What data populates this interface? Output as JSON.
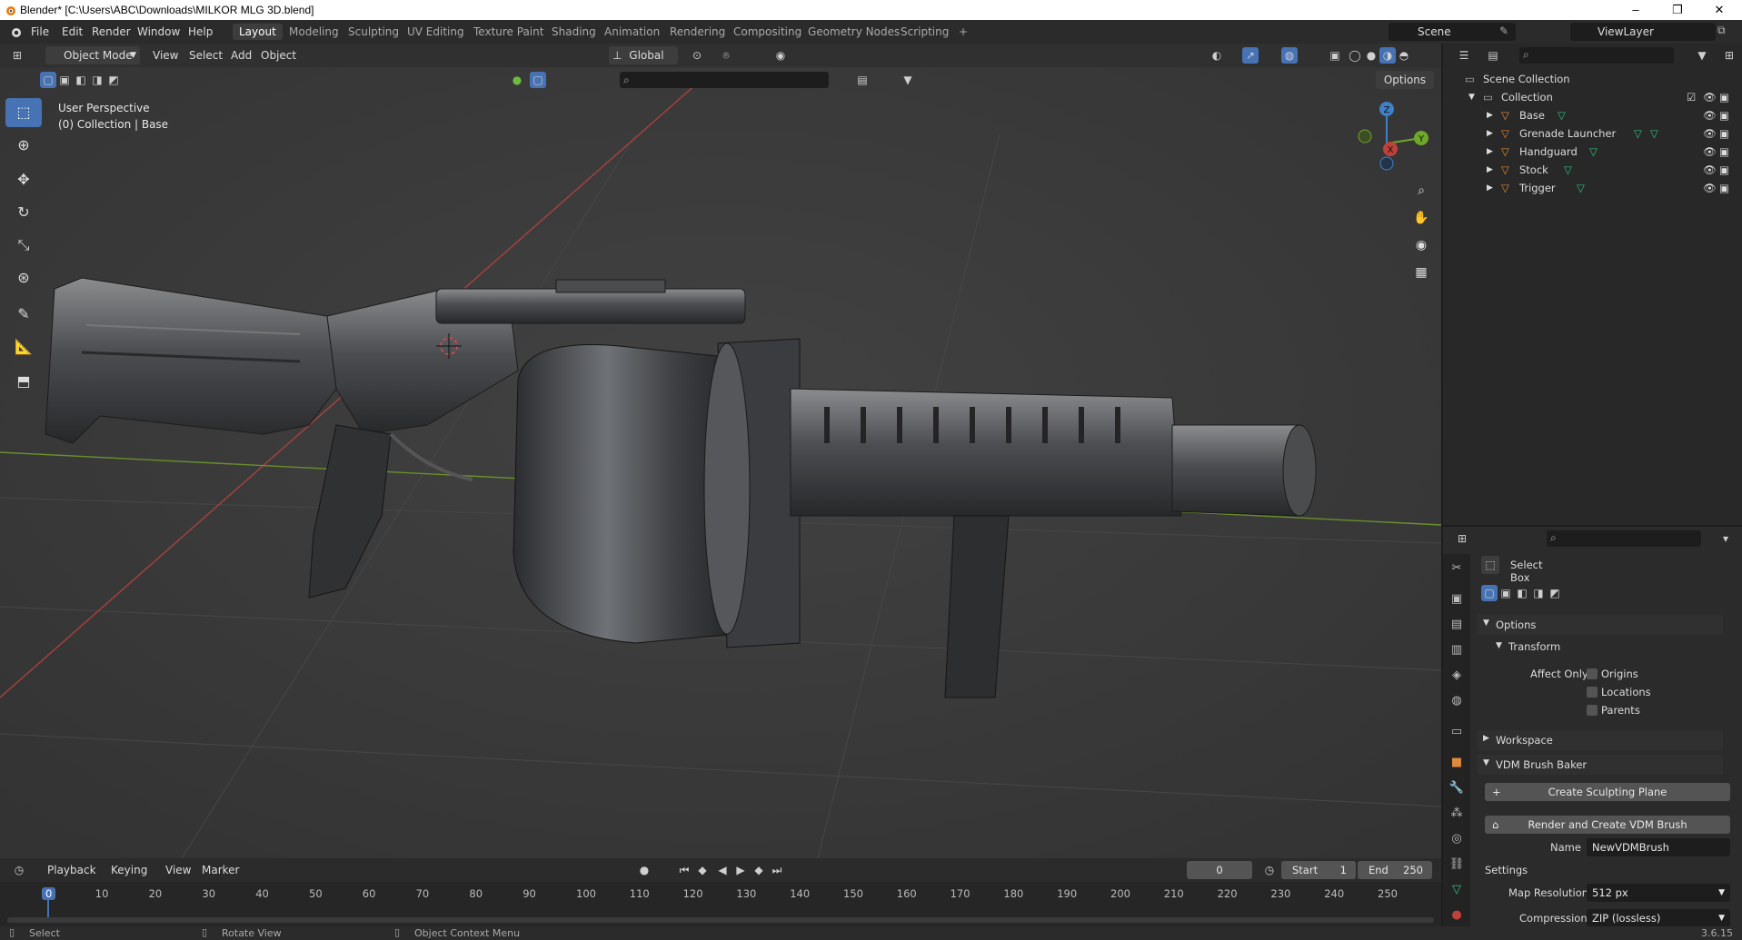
{
  "window": {
    "title": "Blender* [C:\\Users\\ABC\\Downloads\\MILKOR MLG 3D.blend]",
    "controls": [
      "–",
      "❐",
      "✕"
    ]
  },
  "menus": [
    "File",
    "Edit",
    "Render",
    "Window",
    "Help"
  ],
  "workspaces": [
    "Layout",
    "Modeling",
    "Sculpting",
    "UV Editing",
    "Texture Paint",
    "Shading",
    "Animation",
    "Rendering",
    "Compositing",
    "Geometry Nodes",
    "Scripting"
  ],
  "workspace_add": "+",
  "scene": {
    "label": "Scene",
    "view_layer": "ViewLayer"
  },
  "viewport": {
    "mode": "Object Mode",
    "menus": [
      "View",
      "Select",
      "Add",
      "Object"
    ],
    "orientation": "Global",
    "options": "Options",
    "overlay_line1": "User Perspective",
    "overlay_line2": "(0) Collection | Base",
    "axes": {
      "x": "X",
      "y": "Y",
      "z": "Z"
    }
  },
  "outliner": {
    "scene_collection": "Scene Collection",
    "collection": "Collection",
    "objects": [
      "Base",
      "Grenade Launcher",
      "Handguard",
      "Stock",
      "Trigger"
    ]
  },
  "properties": {
    "tool_name": "Select Box",
    "options": "Options",
    "transform": "Transform",
    "affect_only": "Affect Only",
    "checks": [
      "Origins",
      "Locations",
      "Parents"
    ],
    "workspace": "Workspace",
    "vdm": "VDM Brush Baker",
    "create_plane": "Create Sculpting Plane",
    "render_brush": "Render and Create VDM Brush",
    "name_label": "Name",
    "name_value": "NewVDMBrush",
    "settings": "Settings",
    "map_res_label": "Map Resolution",
    "map_res_value": "512 px",
    "compression_label": "Compression",
    "compression_value": "ZIP (lossless)"
  },
  "timeline": {
    "menus": [
      "Playback",
      "Keying",
      "View",
      "Marker"
    ],
    "current_frame": "0",
    "start_label": "Start",
    "start": "1",
    "end_label": "End",
    "end": "250",
    "ticks": [
      "0",
      "10",
      "20",
      "30",
      "40",
      "50",
      "60",
      "70",
      "80",
      "90",
      "100",
      "110",
      "120",
      "130",
      "140",
      "150",
      "160",
      "170",
      "180",
      "190",
      "200",
      "210",
      "220",
      "230",
      "240",
      "250"
    ]
  },
  "status": {
    "select": "Select",
    "rotate": "Rotate View",
    "context": "Object Context Menu",
    "version": "3.6.15"
  },
  "colors": {
    "accent": "#4772b3",
    "frame_marker": "#4772b3",
    "x_axis": "#a8423d",
    "y_axis": "#6a8f2b",
    "object_icon": "#e08a3c",
    "mesh_icon": "#2ec27e"
  }
}
